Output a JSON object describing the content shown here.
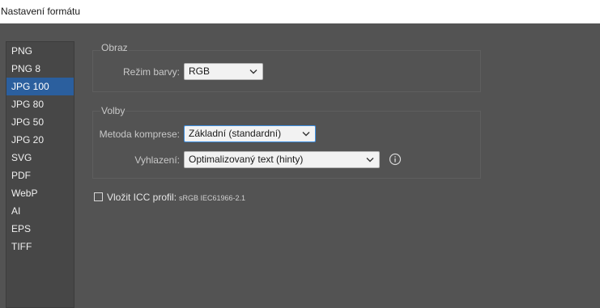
{
  "window": {
    "title": "Nastavení formátu"
  },
  "sidebar": {
    "items": [
      {
        "label": "PNG",
        "selected": false
      },
      {
        "label": "PNG 8",
        "selected": false
      },
      {
        "label": "JPG 100",
        "selected": true
      },
      {
        "label": "JPG 80",
        "selected": false
      },
      {
        "label": "JPG 50",
        "selected": false
      },
      {
        "label": "JPG 20",
        "selected": false
      },
      {
        "label": "SVG",
        "selected": false
      },
      {
        "label": "PDF",
        "selected": false
      },
      {
        "label": "WebP",
        "selected": false
      },
      {
        "label": "AI",
        "selected": false
      },
      {
        "label": "EPS",
        "selected": false
      },
      {
        "label": "TIFF",
        "selected": false
      }
    ]
  },
  "image_group": {
    "title": "Obraz",
    "color_mode_label": "Režim barvy:",
    "color_mode_value": "RGB"
  },
  "options_group": {
    "title": "Volby",
    "compression_label": "Metoda komprese:",
    "compression_value": "Základní (standardní)",
    "smoothing_label": "Vyhlazení:",
    "smoothing_value": "Optimalizovaný text (hinty)"
  },
  "icc": {
    "checked": false,
    "label": "Vložit ICC profil:",
    "value": "sRGB IEC61966-2.1"
  },
  "icons": {
    "chevron": "chevron-down-icon",
    "info": "info-icon"
  },
  "colors": {
    "selection": "#2b5f9e",
    "focus": "#3d8ee0",
    "background": "#535353"
  }
}
